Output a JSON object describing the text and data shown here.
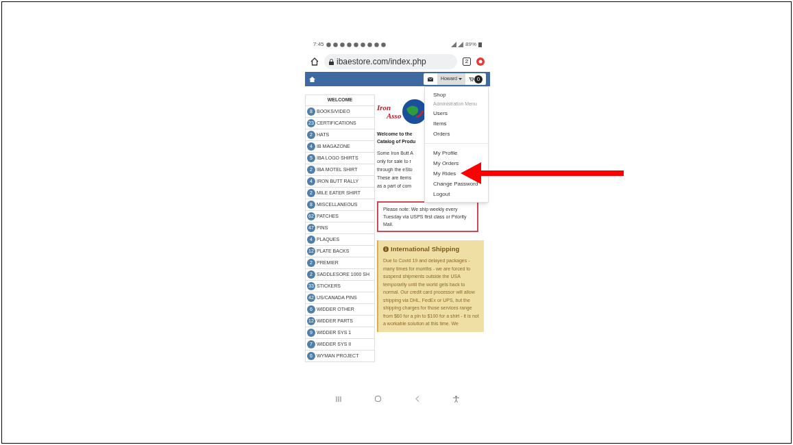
{
  "status_bar": {
    "time": "7:45",
    "battery": "89%"
  },
  "browser": {
    "url": "ibaestore.com/index.php",
    "tab_count": "2"
  },
  "navbar": {
    "user": "Howard",
    "cart_count": "0"
  },
  "menu": [
    {
      "kind": "item",
      "label": "Shop"
    },
    {
      "kind": "header",
      "label": "Administration Menu"
    },
    {
      "kind": "item",
      "label": "Users"
    },
    {
      "kind": "item",
      "label": "Items"
    },
    {
      "kind": "item",
      "label": "Orders"
    },
    {
      "kind": "divider"
    },
    {
      "kind": "item",
      "label": "My Profile"
    },
    {
      "kind": "item",
      "label": "My Orders"
    },
    {
      "kind": "item",
      "label": "My Rides"
    },
    {
      "kind": "item",
      "label": "Change Password"
    },
    {
      "kind": "item",
      "label": "Logout"
    }
  ],
  "sidebar": {
    "title": "WELCOME",
    "items": [
      {
        "count": "8",
        "label": "BOOKS/VIDEO"
      },
      {
        "count": "23",
        "label": "CERTIFICATIONS"
      },
      {
        "count": "2",
        "label": "HATS"
      },
      {
        "count": "4",
        "label": "IB MAGAZONE"
      },
      {
        "count": "5",
        "label": "IBA LOGO SHIRTS"
      },
      {
        "count": "2",
        "label": "IBA MOTEL SHIRT"
      },
      {
        "count": "4",
        "label": "IRON BUTT RALLY"
      },
      {
        "count": "2",
        "label": "MILE EATER SHIRT"
      },
      {
        "count": "8",
        "label": "MISCELLANEOUS"
      },
      {
        "count": "62",
        "label": "PATCHES"
      },
      {
        "count": "47",
        "label": "PINS"
      },
      {
        "count": "4",
        "label": "PLAQUES"
      },
      {
        "count": "12",
        "label": "PLATE BACKS"
      },
      {
        "count": "2",
        "label": "PREMIER"
      },
      {
        "count": "2",
        "label": "SADDLESORE 1000 SH"
      },
      {
        "count": "33",
        "label": "STICKERS"
      },
      {
        "count": "42",
        "label": "US/CANADA PINS"
      },
      {
        "count": "6",
        "label": "WIDDER OTHER"
      },
      {
        "count": "12",
        "label": "WIDDER PARTS"
      },
      {
        "count": "9",
        "label": "WIDDER SYS 1"
      },
      {
        "count": "7",
        "label": "WIDDER SYS II"
      },
      {
        "count": "6",
        "label": "WYMAN PROJECT"
      }
    ]
  },
  "content": {
    "logo_text": [
      "Iron",
      "Asso"
    ],
    "heading_lines": [
      "Welcome to the",
      "Catalog of Produ"
    ],
    "intro_lines": [
      "Some Iron Butt A",
      "only for sale to r",
      "through the eSto",
      "These are items",
      "as a part of com"
    ],
    "note": "Please note: We ship weekly every Tuesday via USPS first class or Priority Mail.",
    "shipping_title": "International Shipping",
    "shipping_text": "Due to Covid 19 and delayed packages - many times for months - we are forced to suspend shipments outside the USA temporarily until the world gets back to normal. Our credit card processor will allow shipping via DHL, FedEx or UPS, but the shipping charges for those services range from $60 for a pin to $100 for a shirt - it is not a workable solution at this time. We"
  }
}
